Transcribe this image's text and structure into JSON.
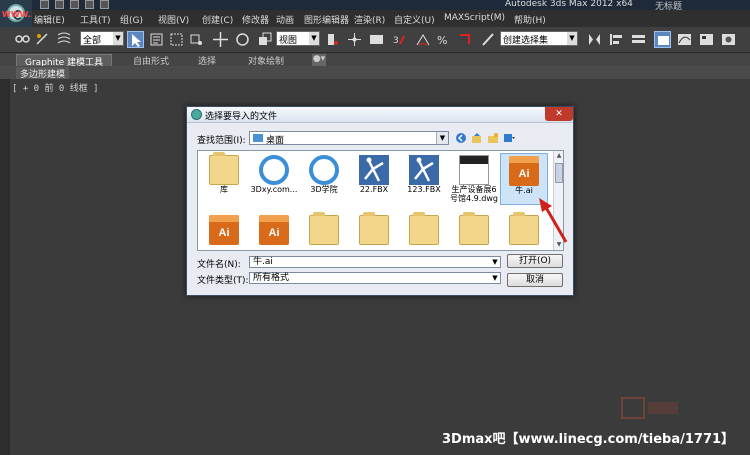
{
  "app": {
    "title": "Autodesk 3ds Max  2012 x64",
    "title_extra": "无标题",
    "watermark_top": "WWW.3DXY.COM"
  },
  "menu": [
    "编辑(E)",
    "工具(T)",
    "组(G)",
    "视图(V)",
    "创建(C)",
    "修改器",
    "动画",
    "图形编辑器",
    "渲染(R)",
    "自定义(U)",
    "MAXScript(M)",
    "帮助(H)"
  ],
  "toolbar": {
    "selection_filter": "全部",
    "reference_coord": "视图",
    "named_selection": "创建选择集"
  },
  "ribbon": {
    "tabs": [
      "Graphite 建模工具",
      "自由形式",
      "选择",
      "对象绘制"
    ],
    "sub_label": "多边形建模"
  },
  "viewport": {
    "label": "[ + 0 前 0 线框 ]"
  },
  "dialog": {
    "title": "选择要导入的文件",
    "close": "✕",
    "look_in_label": "查找范围(I):",
    "look_in_value": "桌面",
    "files": [
      {
        "name": "库",
        "icon": "library-folder-icon"
      },
      {
        "name": "3Dxy.com...",
        "icon": "shortcut-icon"
      },
      {
        "name": "3D学院",
        "icon": "shortcut-icon"
      },
      {
        "name": "22.FBX",
        "icon": "fbx-file-icon"
      },
      {
        "name": "123.FBX",
        "icon": "fbx-file-icon"
      },
      {
        "name": "生产设备展6号馆4.9.dwg",
        "name_line1": "生产设备展6",
        "name_line2": "号馆4.9.dwg",
        "icon": "dwg-file-icon"
      },
      {
        "name": "牛.ai",
        "icon": "ai-file-icon",
        "selected": true
      },
      {
        "name": "",
        "icon": "ai-file-icon"
      },
      {
        "name": "",
        "icon": "ai-file-icon"
      },
      {
        "name": "",
        "icon": "folder-icon"
      },
      {
        "name": "",
        "icon": "folder-icon"
      },
      {
        "name": "",
        "icon": "folder-icon"
      },
      {
        "name": "",
        "icon": "folder-icon"
      },
      {
        "name": "",
        "icon": "folder-icon"
      }
    ],
    "filename_label": "文件名(N):",
    "filename_value": "牛.ai",
    "filetype_label": "文件类型(T):",
    "filetype_value": "所有格式",
    "open_button": "打开(O)",
    "cancel_button": "取消"
  },
  "watermark_bottom": "3Dmax吧【www.linecg.com/tieba/1771】",
  "colors": {
    "accent": "#5b86c0",
    "annotation_arrow": "#d0201a"
  }
}
